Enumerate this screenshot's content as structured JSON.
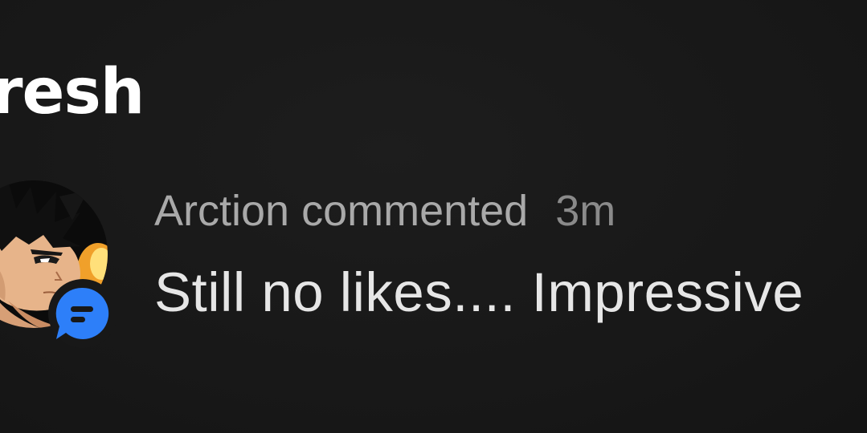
{
  "section": {
    "title": "resh"
  },
  "notification": {
    "actor_line": "Arction commented",
    "time": "3m",
    "comment": "Still no likes.... Impressive",
    "avatar_icon": "user-avatar-anime-character",
    "badge_icon": "comment-bubble-icon",
    "badge_color": "#2d7ff9"
  },
  "theme": {
    "background": "#181818",
    "title_color": "#ffffff",
    "meta_color": "#a9a9a9",
    "time_color": "#8a8a8a",
    "comment_color": "#e6e6e6"
  }
}
